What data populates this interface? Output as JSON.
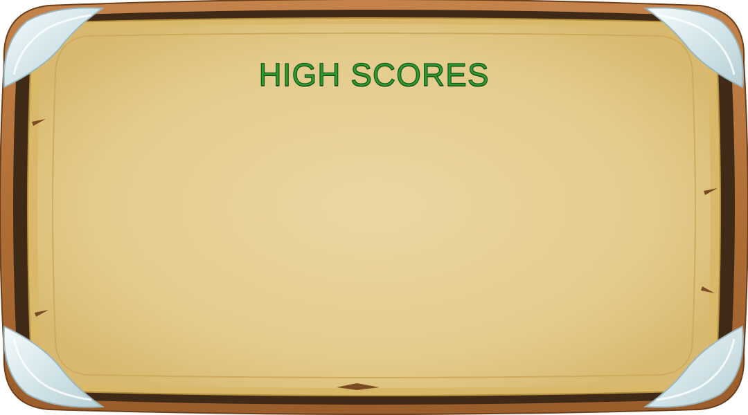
{
  "board": {
    "title": "HIGH SCORES"
  },
  "colors": {
    "title_fill": "#2f9b2c",
    "title_outline": "#17541a",
    "parchment_center": "#ead7a4",
    "parchment_edge": "#dcbe77",
    "wood_outer": "#b9773d",
    "wood_dark": "#3f2a18",
    "corner_metal": "#dfeff2"
  },
  "scores": []
}
